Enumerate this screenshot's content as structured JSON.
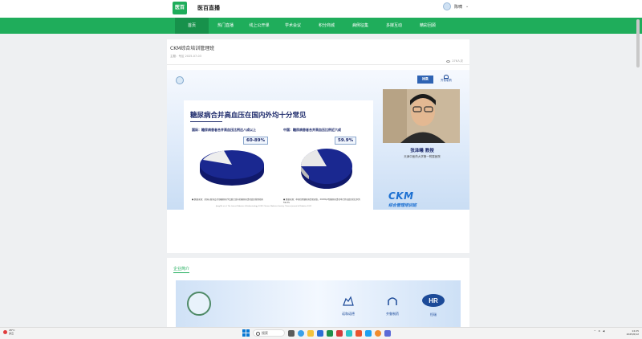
{
  "header": {
    "logo_text": "医百",
    "site_name": "医百直播",
    "user_name": "陈啸"
  },
  "nav": {
    "items": [
      "首页",
      "热门直播",
      "线上公开课",
      "学术会议",
      "积分商城",
      "病例征集",
      "多媒互动",
      "精彩回顾"
    ],
    "active_index": 0
  },
  "page": {
    "title": "CKM综合培训管理班",
    "meta": "主题：专区  2025-07-03",
    "views": "276人次"
  },
  "video": {
    "logo_left": "HR",
    "logo_right": "齐鲁制药",
    "slide": {
      "title": "糖尿病合并高血压在国内外均十分常见",
      "left_heading": "国际：糖尿病患者合并高血压比例达八成以上",
      "right_heading": "中国：糖尿病患者合并高血压比例近六成",
      "left_value": "60-89%",
      "right_value": "59.9%",
      "left_note": "●  数据来源：美国心脏协会/美国糖尿病学会联合发布的糖尿病患者血压管理指南",
      "right_note": "●  数据来源：中国住院糖尿病患者调查，2018年2型糖尿病患者中合并高血压的比例为59.9%",
      "footnote": "Jiang Ms et al. The Lancet Diabetes & Endocrinology 2018; Chinese Diabetes Society. Chinese Journal of Diabetes 2021"
    },
    "presenter_name": "张泽曦  教授",
    "presenter_org": "天津中医药大学第一附属医院",
    "ckm_title": "CKM",
    "ckm_subtitle": "综合管理培训班"
  },
  "enterprise": {
    "title": "企业简介",
    "logos": [
      "诺和诺德",
      "齐鲁制药",
      "恒瑞"
    ]
  },
  "taskbar": {
    "weather_temp": "28°C",
    "weather_text": "多云",
    "search_label": "搜索",
    "time": "14:25",
    "date": "2025/6/12"
  },
  "colors": {
    "brand_green": "#1fad5b",
    "navy": "#1d2a6b",
    "accent_blue": "#1b6fd1"
  }
}
